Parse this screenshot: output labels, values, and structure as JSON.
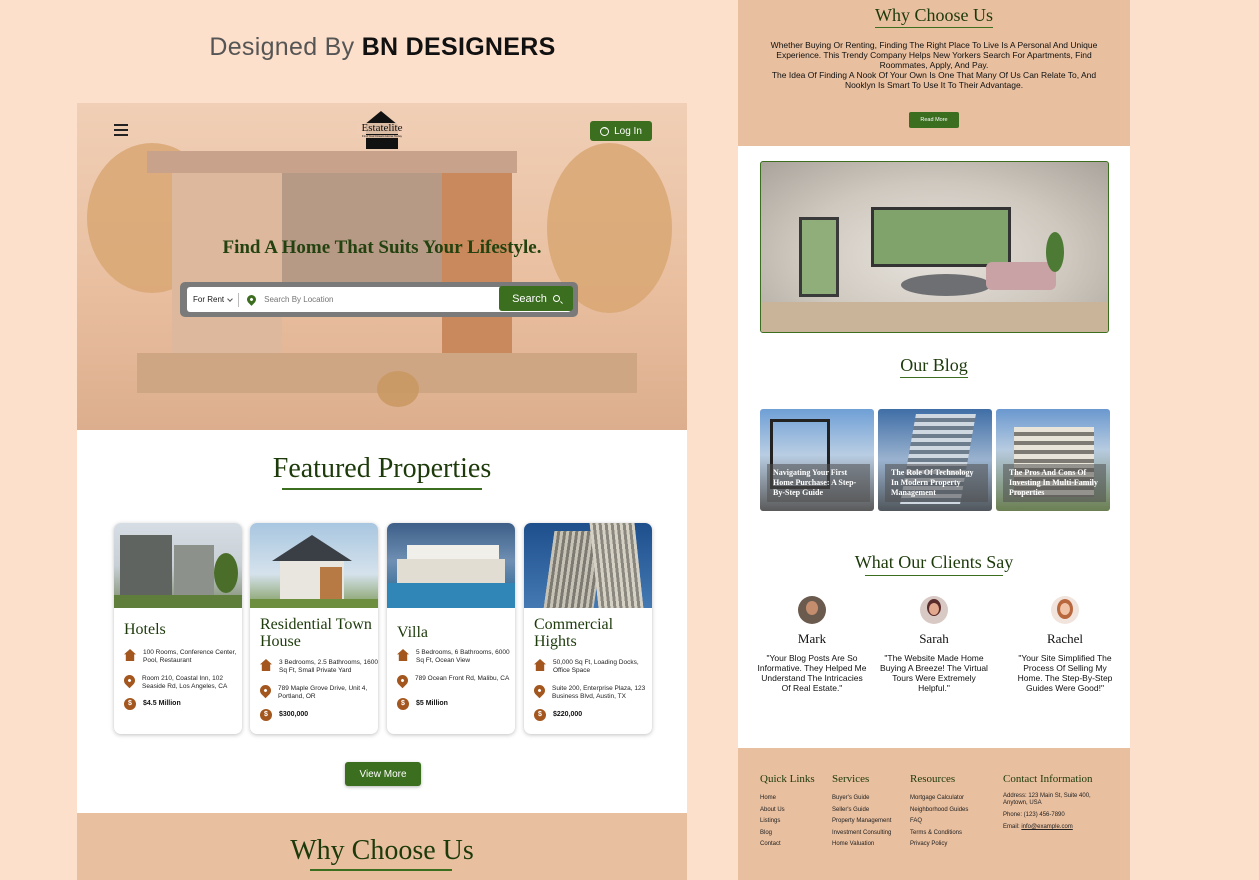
{
  "credit": {
    "prefix": "Designed By",
    "brand": "BN DESIGNERS"
  },
  "header": {
    "logo_text": "Estatelite",
    "logo_tagline": "Find Your Dream Home Today",
    "login_label": "Log In"
  },
  "hero": {
    "title": "Find  A Home That Suits Your Lifestyle."
  },
  "search": {
    "mode_selected": "For Rent",
    "placeholder": "Search By Location",
    "button_label": "Search"
  },
  "featured": {
    "title": "Featured Properties",
    "cards": [
      {
        "title": "Hotels",
        "features": "100 Rooms, Conference Center, Pool, Restaurant",
        "address": "Room 210, Coastal Inn, 102 Seaside Rd, Los Angeles, CA",
        "price": "$4.5 Million"
      },
      {
        "title": "Residential Town House",
        "features": "3 Bedrooms, 2.5 Bathrooms, 1600 Sq Ft, Small Private Yard",
        "address": "789 Maple Grove Drive, Unit 4, Portland, OR",
        "price": "$300,000"
      },
      {
        "title": "Villa",
        "features": "5 Bedrooms, 6 Bathrooms, 6000 Sq Ft, Ocean View",
        "address": "789 Ocean Front Rd, Malibu, CA",
        "price": "$5 Million"
      },
      {
        "title": "Commercial Hights",
        "features": "50,000 Sq Ft, Loading Docks, Office Space",
        "address": "Suite 200, Enterprise Plaza, 123 Business Blvd, Austin, TX",
        "price": "$220,000"
      }
    ],
    "view_more_label": "View More"
  },
  "why": {
    "title": "Why Choose Us",
    "paragraph1": "Whether Buying Or Renting, Finding The Right Place To Live Is A Personal And Unique Experience. This Trendy Company Helps New Yorkers Search For Apartments, Find Roommates, Apply, And Pay.",
    "paragraph2": "The Idea Of Finding A Nook Of Your Own Is One That Many Of Us Can Relate To, And Nooklyn Is Smart To Use It To Their Advantage.",
    "read_more_label": "Read More"
  },
  "blog": {
    "title": "Our Blog",
    "posts": [
      "Navigating Your First Home Purchase: A Step-By-Step Guide",
      "The Role Of Technology In Modern Property Management",
      "The Pros And Cons Of Investing In Multi-Family Properties"
    ]
  },
  "clients": {
    "title": "What Our Clients Say",
    "items": [
      {
        "name": "Mark",
        "quote": "\"Your Blog Posts Are So Informative. They Helped Me Understand The Intricacies Of Real Estate.\""
      },
      {
        "name": "Sarah",
        "quote": "\"The Website Made Home Buying A Breeze! The Virtual Tours Were Extremely Helpful.\""
      },
      {
        "name": "Rachel",
        "quote": "\"Your Site Simplified The Process Of Selling My Home. The Step-By-Step Guides Were Good!\""
      }
    ]
  },
  "footer": {
    "quick_links": {
      "title": "Quick Links",
      "links": [
        "Home",
        "About Us",
        "Listings",
        "Blog",
        "Contact"
      ]
    },
    "services": {
      "title": "Services",
      "links": [
        "Buyer's Guide",
        "Seller's Guide",
        "Property Management",
        "Investment Consulting",
        "Home Valuation"
      ]
    },
    "resources": {
      "title": "Resources",
      "links": [
        "Mortgage Calculator",
        "Neighborhood Guides",
        "FAQ",
        "Terms & Conditions",
        "Privacy Policy"
      ]
    },
    "contact": {
      "title": "Contact Information",
      "address": "Address: 123 Main St, Suite 400, Anytown, USA",
      "phone": "Phone: (123) 456-7890",
      "email_label": "Email: ",
      "email": "info@example.com"
    }
  },
  "colors": {
    "accent_green": "#3b6e1f",
    "heading_green": "#1d3a0b",
    "peach_bg": "#fde0cb",
    "section_tan": "#e8bf9f",
    "icon_brown": "#a3571e"
  }
}
